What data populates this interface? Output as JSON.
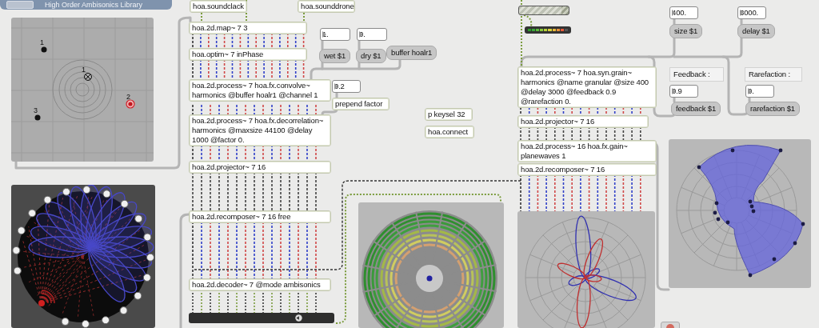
{
  "header": {
    "title": "High Order Ambisonics Library"
  },
  "map": {
    "sources": [
      {
        "label": "1",
        "selected": false
      },
      {
        "label": "2",
        "selected": true
      },
      {
        "label": "3",
        "selected": false
      }
    ],
    "groups": [
      {
        "label": "1"
      }
    ]
  },
  "gain_slider": {
    "level": 0.85
  },
  "meter": {
    "level": 0.9
  },
  "boxes": [
    {
      "kind": "object",
      "text": "hoa.soundclack"
    },
    {
      "kind": "object",
      "text": "hoa.sounddrone"
    },
    {
      "kind": "object",
      "text": "hoa.2d.map~ 7 3"
    },
    {
      "kind": "object",
      "text": "hoa.optim~ 7 inPhase"
    },
    {
      "kind": "number",
      "text": "1."
    },
    {
      "kind": "number",
      "text": "0."
    },
    {
      "kind": "message",
      "text": "wet $1"
    },
    {
      "kind": "message",
      "text": "dry $1"
    },
    {
      "kind": "message",
      "text": "buffer hoalr1"
    },
    {
      "kind": "object",
      "text": "hoa.2d.process~ 7 hoa.fx.convolve~ harmonics @buffer hoalr1 @channel 1"
    },
    {
      "kind": "number",
      "text": "0.2"
    },
    {
      "kind": "object",
      "text": "prepend factor"
    },
    {
      "kind": "object",
      "text": "hoa.2d.process~ 7 hoa.fx.decorrelation~ harmonics @maxsize 44100 @delay 1000 @factor 0."
    },
    {
      "kind": "object",
      "text": "p keysel 32"
    },
    {
      "kind": "object",
      "text": "hoa.connect"
    },
    {
      "kind": "object",
      "text": "hoa.2d.projector~ 7 16"
    },
    {
      "kind": "object",
      "text": "hoa.2d.recomposer~ 7 16 free"
    },
    {
      "kind": "object",
      "text": "hoa.2d.decoder~ 7 @mode ambisonics"
    },
    {
      "kind": "number",
      "text": "400."
    },
    {
      "kind": "number",
      "text": "3000."
    },
    {
      "kind": "message",
      "text": "size $1"
    },
    {
      "kind": "message",
      "text": "delay $1"
    },
    {
      "kind": "comment",
      "text": "Feedback :"
    },
    {
      "kind": "comment",
      "text": "Rarefaction :"
    },
    {
      "kind": "number",
      "text": "0.9"
    },
    {
      "kind": "number",
      "text": "0."
    },
    {
      "kind": "message",
      "text": "feedback $1"
    },
    {
      "kind": "message",
      "text": "rarefaction $1"
    },
    {
      "kind": "object",
      "text": "hoa.2d.process~ 7 hoa.syn.grain~ harmonics @name granular @size 400 @delay 3000 @feedback 0.9 @rarefaction 0."
    },
    {
      "kind": "object",
      "text": "hoa.2d.projector~ 7 16"
    },
    {
      "kind": "object",
      "text": "hoa.2d.process~ 16 hoa.fx.gain~ planewaves 1"
    },
    {
      "kind": "object",
      "text": "hoa.2d.recomposer~ 7 16"
    }
  ]
}
